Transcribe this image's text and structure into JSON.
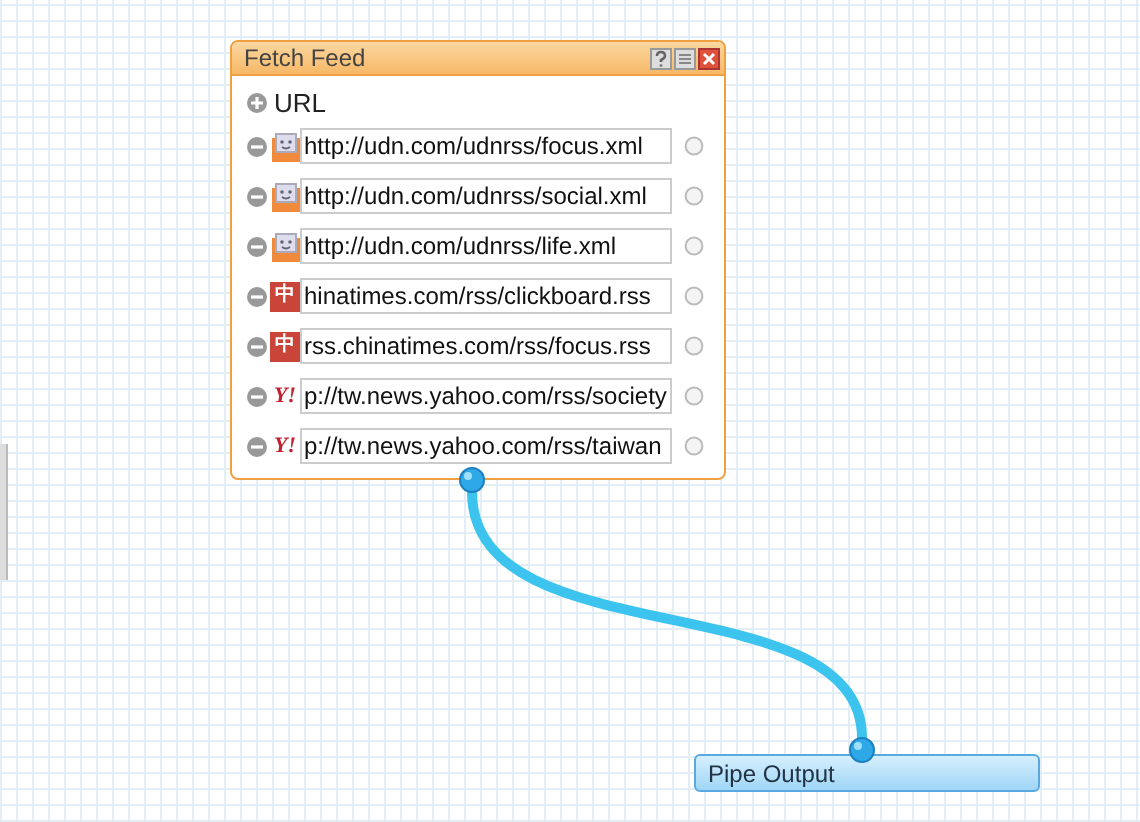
{
  "module": {
    "title": "Fetch Feed",
    "add_label": "URL",
    "feeds": [
      {
        "kind": "udn",
        "url": "http://udn.com/udnrss/focus.xml"
      },
      {
        "kind": "udn",
        "url": "http://udn.com/udnrss/social.xml"
      },
      {
        "kind": "udn",
        "url": "http://udn.com/udnrss/life.xml"
      },
      {
        "kind": "chinatimes",
        "badge": "中",
        "url": "hinatimes.com/rss/clickboard.rss"
      },
      {
        "kind": "chinatimes",
        "badge": "中",
        "url": "rss.chinatimes.com/rss/focus.rss"
      },
      {
        "kind": "yahoo",
        "badge": "Y!",
        "url": "p://tw.news.yahoo.com/rss/society"
      },
      {
        "kind": "yahoo",
        "badge": "Y!",
        "url": "p://tw.news.yahoo.com/rss/taiwan"
      }
    ]
  },
  "output": {
    "title": "Pipe Output"
  }
}
